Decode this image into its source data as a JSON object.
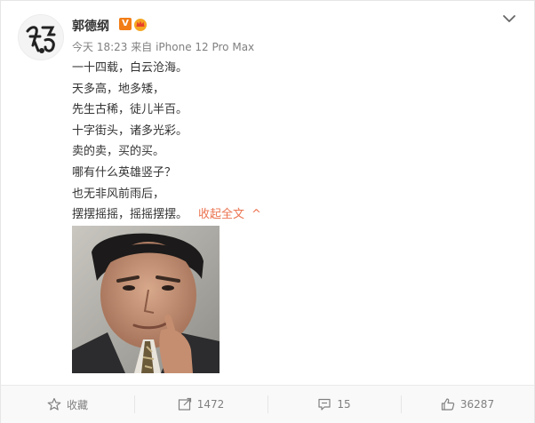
{
  "post": {
    "author": "郭德纲",
    "verified_badge": "V",
    "time": "今天 18:23",
    "source_prefix": "来自",
    "source": "iPhone 12 Pro Max",
    "lines": [
      "一十四载，白云沧海。",
      "天多高，地多矮，",
      "先生古稀，徒儿半百。",
      "十字街头，诸多光彩。",
      "卖的卖，买的买。",
      "哪有什么英雄竖子？",
      "也无非风前雨后，",
      "摆摆摇摇，摇摇摆摆。"
    ],
    "collapse_label": "收起全文",
    "collapse_caret": "^"
  },
  "footer": {
    "favorite_label": "收藏",
    "repost_count": "1472",
    "comment_count": "15",
    "like_count": "36287"
  },
  "colors": {
    "accent": "#eb7350",
    "verified": "#f27d16",
    "muted": "#808080"
  },
  "icons": {
    "menu": "chevron-down-icon",
    "favorite": "star-icon",
    "repost": "repost-icon",
    "comment": "comment-icon",
    "like": "thumbs-up-icon"
  }
}
